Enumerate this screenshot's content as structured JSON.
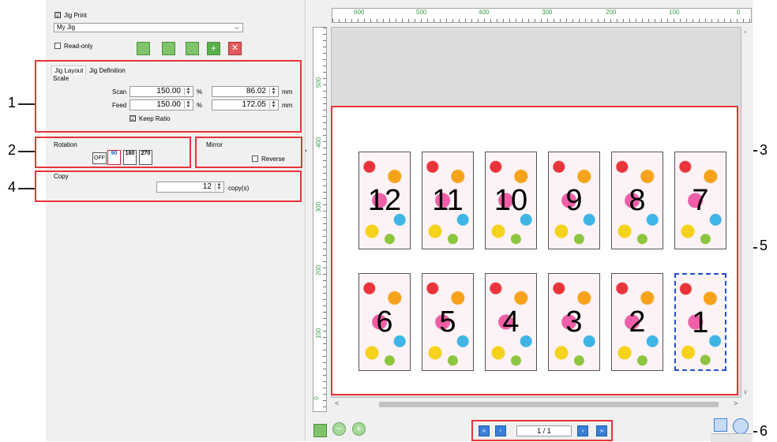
{
  "left": {
    "jig_print_label": "Jig Print",
    "jig_print_checked": "☑",
    "jig_select": "My Jig",
    "readonly_label": "Read-only",
    "tabs": [
      {
        "label": "Jig Layout"
      },
      {
        "label": "Jig Definition"
      }
    ],
    "scale": {
      "title": "Scale",
      "scan_label": "Scan",
      "scan_percent": "150.00",
      "scan_mm": "86.02",
      "feed_label": "Feed",
      "feed_percent": "150.00",
      "feed_mm": "172.05",
      "unit_percent": "%",
      "unit_mm": "mm",
      "keep_ratio_label": "Keep Ratio",
      "keep_ratio_checked": "☑"
    },
    "rotation": {
      "title": "Rotation",
      "buttons": [
        "OFF",
        "90",
        "180",
        "270"
      ]
    },
    "mirror": {
      "title": "Mirror",
      "reverse_label": "Reverse"
    },
    "copy": {
      "title": "Copy",
      "value": "12",
      "unit": "copy(s)"
    }
  },
  "callouts": [
    "1",
    "2",
    "3",
    "4",
    "5",
    "6"
  ],
  "ruler_top": [
    "600",
    "500",
    "400",
    "300",
    "200",
    "100",
    "0"
  ],
  "ruler_left": [
    "500",
    "400",
    "300",
    "200",
    "100",
    "0"
  ],
  "tiles_row1": [
    "12",
    "11",
    "10",
    "9",
    "8",
    "7"
  ],
  "tiles_row2": [
    "6",
    "5",
    "4",
    "3",
    "2",
    "1"
  ],
  "pager": {
    "value": "1 / 1"
  },
  "colors": {
    "callout_box": "#e8343a",
    "selected_tile": "#1f4fd0"
  }
}
